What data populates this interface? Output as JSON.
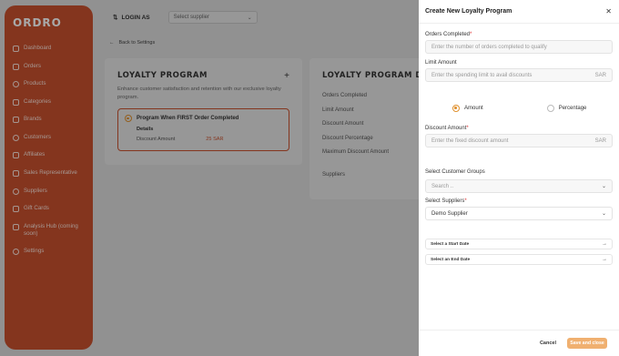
{
  "app": {
    "logo": "ORDRO",
    "sidebar": {
      "items": [
        {
          "label": "Dashboard",
          "icon": "grid-icon"
        },
        {
          "label": "Orders",
          "icon": "orders-icon"
        },
        {
          "label": "Products",
          "icon": "box-icon"
        },
        {
          "label": "Categories",
          "icon": "layers-icon"
        },
        {
          "label": "Brands",
          "icon": "tag-icon"
        },
        {
          "label": "Customers",
          "icon": "users-icon"
        },
        {
          "label": "Affiliates",
          "icon": "affiliates-icon"
        },
        {
          "label": "Sales Representative",
          "icon": "person-icon"
        },
        {
          "label": "Suppliers",
          "icon": "truck-icon"
        },
        {
          "label": "Gift Cards",
          "icon": "gift-icon"
        },
        {
          "label": "Analysis Hub (coming soon)",
          "icon": "chart-icon"
        },
        {
          "label": "Settings",
          "icon": "gear-icon"
        }
      ]
    },
    "topbar": {
      "login_as": "LOGIN AS",
      "supplier_placeholder": "Select supplier"
    },
    "back_label": "Back to Settings",
    "loyalty_card": {
      "title": "LOYALTY PROGRAM",
      "description": "Enhance customer satisfaction and retention with our exclusive loyalty program.",
      "program": {
        "title": "Program When FIRST Order Completed",
        "details_label": "Details",
        "row_label": "Discount Amount",
        "row_value": "25 SAR"
      }
    },
    "details_card": {
      "title": "LOYALTY PROGRAM DETAILS",
      "lines": [
        "Orders Completed",
        "Limit Amount",
        "Discount Amount",
        "Discount Percentage",
        "Maximum Discount Amount"
      ],
      "suppliers_label": "Suppliers"
    }
  },
  "drawer": {
    "title": "Create New Loyalty Program",
    "orders_completed": {
      "label": "Orders Completed",
      "required_mark": "*",
      "placeholder": "Enter the number of orders completed to qualify"
    },
    "limit_amount": {
      "label": "Limit Amount",
      "placeholder": "Enter the spending limit to avail discounts",
      "suffix": "SAR"
    },
    "discount_type": {
      "options": [
        "Amount",
        "Percentage"
      ],
      "selected": "Amount"
    },
    "discount_amount": {
      "label": "Discount Amount",
      "required_mark": "*",
      "placeholder": "Enter the fixed discount amount",
      "suffix": "SAR"
    },
    "customer_groups": {
      "label": "Select Customer Groups",
      "placeholder": "Search .."
    },
    "suppliers": {
      "label": "Select Suppliers",
      "required_mark": "*",
      "value": "Demo Supplier"
    },
    "start_date": "Select a Start Date",
    "end_date": "Select an End Date",
    "cancel": "Cancel",
    "save": "Save and close"
  },
  "colors": {
    "brand": "#c9512e",
    "accent": "#e0912f",
    "save_button": "#f0b070"
  }
}
